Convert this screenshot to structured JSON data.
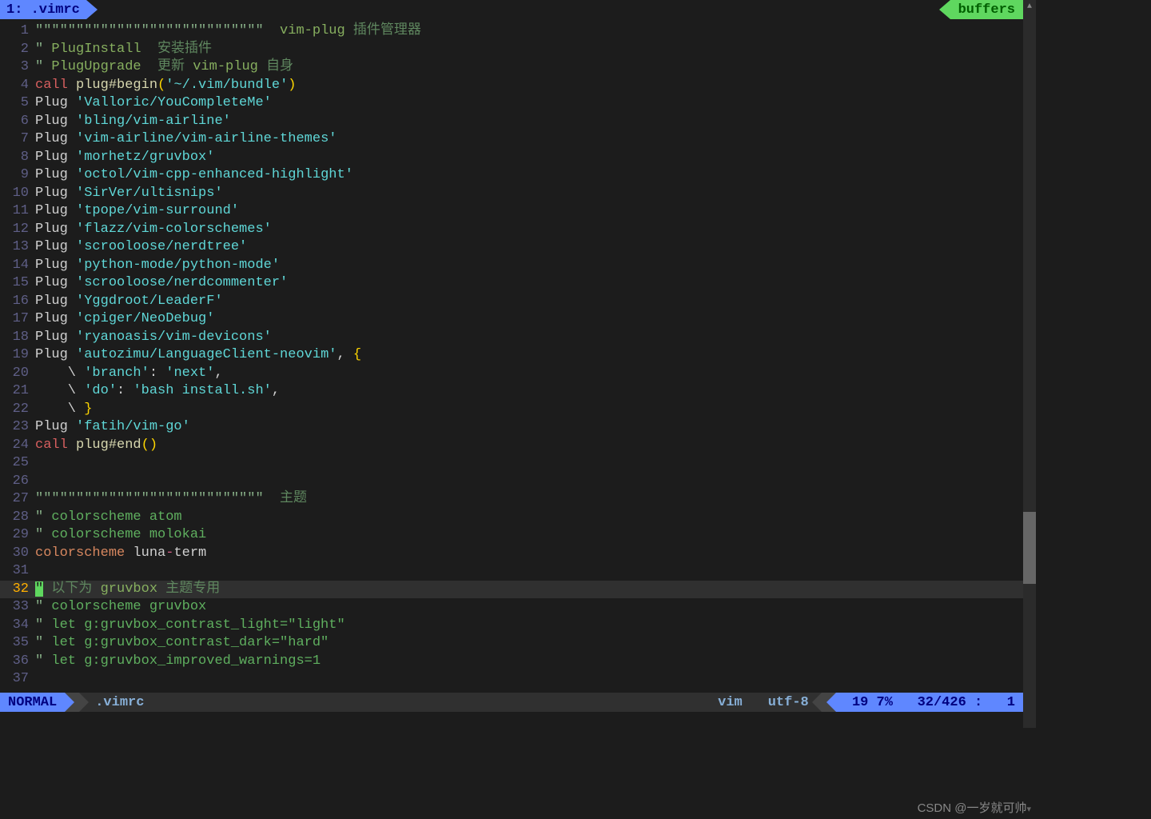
{
  "tab": {
    "index": "1:",
    "name": ".vimrc"
  },
  "buffers_label": "buffers",
  "lines": [
    {
      "n": 1,
      "seg": [
        {
          "c": "c-quote",
          "t": "\"\"\"\"\"\"\"\"\"\"\"\"\"\"\"\"\"\"\"\"\"\"\"\"\"\"\"\" "
        },
        {
          "c": "c-green",
          "t": " vim-plug "
        },
        {
          "c": "c-comment-cjk",
          "t": "插件管理器"
        }
      ]
    },
    {
      "n": 2,
      "seg": [
        {
          "c": "c-quote",
          "t": "\" "
        },
        {
          "c": "c-green",
          "t": "PlugInstall "
        },
        {
          "c": "c-comment-cjk",
          "t": " 安装插件"
        }
      ]
    },
    {
      "n": 3,
      "seg": [
        {
          "c": "c-quote",
          "t": "\" "
        },
        {
          "c": "c-green",
          "t": "PlugUpgrade "
        },
        {
          "c": "c-comment-cjk",
          "t": " 更新 "
        },
        {
          "c": "c-green",
          "t": "vim-plug "
        },
        {
          "c": "c-comment-cjk",
          "t": "自身"
        }
      ]
    },
    {
      "n": 4,
      "seg": [
        {
          "c": "c-key",
          "t": "call"
        },
        {
          "c": "c-plug",
          "t": " "
        },
        {
          "c": "c-func",
          "t": "plug#begin"
        },
        {
          "c": "c-paren",
          "t": "("
        },
        {
          "c": "c-string",
          "t": "'~/.vim/bundle'"
        },
        {
          "c": "c-paren",
          "t": ")"
        }
      ]
    },
    {
      "n": 5,
      "seg": [
        {
          "c": "c-plug",
          "t": "Plug "
        },
        {
          "c": "c-string",
          "t": "'Valloric/YouCompleteMe'"
        }
      ]
    },
    {
      "n": 6,
      "seg": [
        {
          "c": "c-plug",
          "t": "Plug "
        },
        {
          "c": "c-string",
          "t": "'bling/vim-airline'"
        }
      ]
    },
    {
      "n": 7,
      "seg": [
        {
          "c": "c-plug",
          "t": "Plug "
        },
        {
          "c": "c-string",
          "t": "'vim-airline/vim-airline-themes'"
        }
      ]
    },
    {
      "n": 8,
      "seg": [
        {
          "c": "c-plug",
          "t": "Plug "
        },
        {
          "c": "c-string",
          "t": "'morhetz/gruvbox'"
        }
      ]
    },
    {
      "n": 9,
      "seg": [
        {
          "c": "c-plug",
          "t": "Plug "
        },
        {
          "c": "c-string",
          "t": "'octol/vim-cpp-enhanced-highlight'"
        }
      ]
    },
    {
      "n": 10,
      "seg": [
        {
          "c": "c-plug",
          "t": "Plug "
        },
        {
          "c": "c-string",
          "t": "'SirVer/ultisnips'"
        }
      ]
    },
    {
      "n": 11,
      "seg": [
        {
          "c": "c-plug",
          "t": "Plug "
        },
        {
          "c": "c-string",
          "t": "'tpope/vim-surround'"
        }
      ]
    },
    {
      "n": 12,
      "seg": [
        {
          "c": "c-plug",
          "t": "Plug "
        },
        {
          "c": "c-string",
          "t": "'flazz/vim-colorschemes'"
        }
      ]
    },
    {
      "n": 13,
      "seg": [
        {
          "c": "c-plug",
          "t": "Plug "
        },
        {
          "c": "c-string",
          "t": "'scrooloose/nerdtree'"
        }
      ]
    },
    {
      "n": 14,
      "seg": [
        {
          "c": "c-plug",
          "t": "Plug "
        },
        {
          "c": "c-string",
          "t": "'python-mode/python-mode'"
        }
      ]
    },
    {
      "n": 15,
      "seg": [
        {
          "c": "c-plug",
          "t": "Plug "
        },
        {
          "c": "c-string",
          "t": "'scrooloose/nerdcommenter'"
        }
      ]
    },
    {
      "n": 16,
      "seg": [
        {
          "c": "c-plug",
          "t": "Plug "
        },
        {
          "c": "c-string",
          "t": "'Yggdroot/LeaderF'"
        }
      ]
    },
    {
      "n": 17,
      "seg": [
        {
          "c": "c-plug",
          "t": "Plug "
        },
        {
          "c": "c-string",
          "t": "'cpiger/NeoDebug'"
        }
      ]
    },
    {
      "n": 18,
      "seg": [
        {
          "c": "c-plug",
          "t": "Plug "
        },
        {
          "c": "c-string",
          "t": "'ryanoasis/vim-devicons'"
        }
      ]
    },
    {
      "n": 19,
      "seg": [
        {
          "c": "c-plug",
          "t": "Plug "
        },
        {
          "c": "c-string",
          "t": "'autozimu/LanguageClient-neovim'"
        },
        {
          "c": "c-plug",
          "t": ", "
        },
        {
          "c": "c-brace",
          "t": "{"
        }
      ]
    },
    {
      "n": 20,
      "seg": [
        {
          "c": "c-plug",
          "t": "    \\ "
        },
        {
          "c": "c-string",
          "t": "'branch'"
        },
        {
          "c": "c-plug",
          "t": ": "
        },
        {
          "c": "c-string",
          "t": "'next'"
        },
        {
          "c": "c-plug",
          "t": ","
        }
      ]
    },
    {
      "n": 21,
      "seg": [
        {
          "c": "c-plug",
          "t": "    \\ "
        },
        {
          "c": "c-string",
          "t": "'do'"
        },
        {
          "c": "c-plug",
          "t": ": "
        },
        {
          "c": "c-string",
          "t": "'bash install.sh'"
        },
        {
          "c": "c-plug",
          "t": ","
        }
      ]
    },
    {
      "n": 22,
      "seg": [
        {
          "c": "c-plug",
          "t": "    \\ "
        },
        {
          "c": "c-brace",
          "t": "}"
        }
      ]
    },
    {
      "n": 23,
      "seg": [
        {
          "c": "c-plug",
          "t": "Plug "
        },
        {
          "c": "c-string",
          "t": "'fatih/vim-go'"
        }
      ]
    },
    {
      "n": 24,
      "seg": [
        {
          "c": "c-key",
          "t": "call"
        },
        {
          "c": "c-plug",
          "t": " "
        },
        {
          "c": "c-func",
          "t": "plug#end"
        },
        {
          "c": "c-paren",
          "t": "()"
        }
      ]
    },
    {
      "n": 25,
      "seg": []
    },
    {
      "n": 26,
      "seg": []
    },
    {
      "n": 27,
      "seg": [
        {
          "c": "c-quote",
          "t": "\"\"\"\"\"\"\"\"\"\"\"\"\"\"\"\"\"\"\"\"\"\"\"\"\"\"\"\" "
        },
        {
          "c": "c-comment-cjk",
          "t": " 主题"
        }
      ]
    },
    {
      "n": 28,
      "seg": [
        {
          "c": "c-quote",
          "t": "\" "
        },
        {
          "c": "c-comment",
          "t": "colorscheme atom"
        }
      ]
    },
    {
      "n": 29,
      "seg": [
        {
          "c": "c-quote",
          "t": "\" "
        },
        {
          "c": "c-comment",
          "t": "colorscheme molokai"
        }
      ]
    },
    {
      "n": 30,
      "seg": [
        {
          "c": "c-colorscheme",
          "t": "colorscheme"
        },
        {
          "c": "c-plug",
          "t": " "
        },
        {
          "c": "c-luna",
          "t": "luna"
        },
        {
          "c": "c-op",
          "t": "-"
        },
        {
          "c": "c-luna",
          "t": "term"
        }
      ]
    },
    {
      "n": 31,
      "seg": []
    },
    {
      "n": 32,
      "current": true,
      "seg": [
        {
          "c": "cursor-block",
          "t": "\""
        },
        {
          "c": "c-comment-cjk",
          "t": " 以下为 "
        },
        {
          "c": "c-green",
          "t": "gruvbox "
        },
        {
          "c": "c-comment-cjk",
          "t": "主题专用"
        }
      ]
    },
    {
      "n": 33,
      "seg": [
        {
          "c": "c-quote",
          "t": "\" "
        },
        {
          "c": "c-comment",
          "t": "colorscheme gruvbox"
        }
      ]
    },
    {
      "n": 34,
      "seg": [
        {
          "c": "c-quote",
          "t": "\" "
        },
        {
          "c": "c-comment",
          "t": "let g:gruvbox_contrast_light=\"light\""
        }
      ]
    },
    {
      "n": 35,
      "seg": [
        {
          "c": "c-quote",
          "t": "\" "
        },
        {
          "c": "c-comment",
          "t": "let g:gruvbox_contrast_dark=\"hard\""
        }
      ]
    },
    {
      "n": 36,
      "seg": [
        {
          "c": "c-quote",
          "t": "\" "
        },
        {
          "c": "c-comment",
          "t": "let g:gruvbox_improved_warnings=1"
        }
      ]
    },
    {
      "n": 37,
      "seg": []
    }
  ],
  "status": {
    "mode": "NORMAL",
    "file": ".vimrc",
    "filetype": "vim",
    "encoding": "utf-8",
    "position": " 19 7%   32/426 :   1"
  },
  "watermark": "CSDN @一岁就可帅"
}
